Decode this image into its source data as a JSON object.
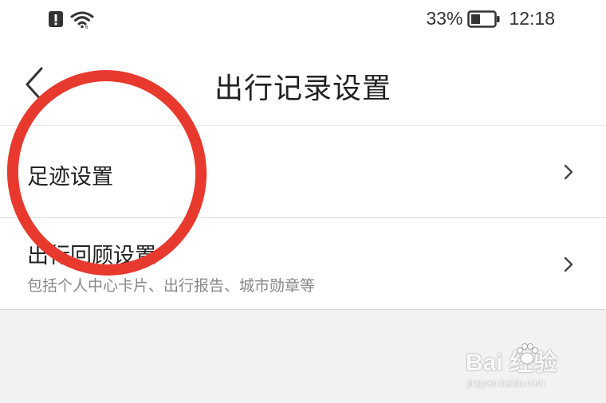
{
  "status_bar": {
    "battery_percent": "33%",
    "time": "12:18",
    "icons": [
      "alert-icon",
      "wifi-icon",
      "battery-icon"
    ]
  },
  "header": {
    "back_icon": "chevron-left-icon",
    "title": "出行记录设置"
  },
  "settings": {
    "items": [
      {
        "title": "足迹设置",
        "subtitle": "",
        "icon": "chevron-right-icon"
      },
      {
        "title": "出行回顾设置",
        "subtitle": "包括个人中心卡片、出行报告、城市勋章等",
        "icon": "chevron-right-icon"
      }
    ]
  },
  "annotation": {
    "color": "#e8392f",
    "shape": "circle around 足迹设置"
  },
  "watermark": {
    "brand": "Bai  经验",
    "url": "jingyan.baidu.com"
  },
  "colors": {
    "background": "#ffffff",
    "divider": "#dcdcdc",
    "gray_area": "#f2f2f2",
    "subtitle": "#888888"
  }
}
